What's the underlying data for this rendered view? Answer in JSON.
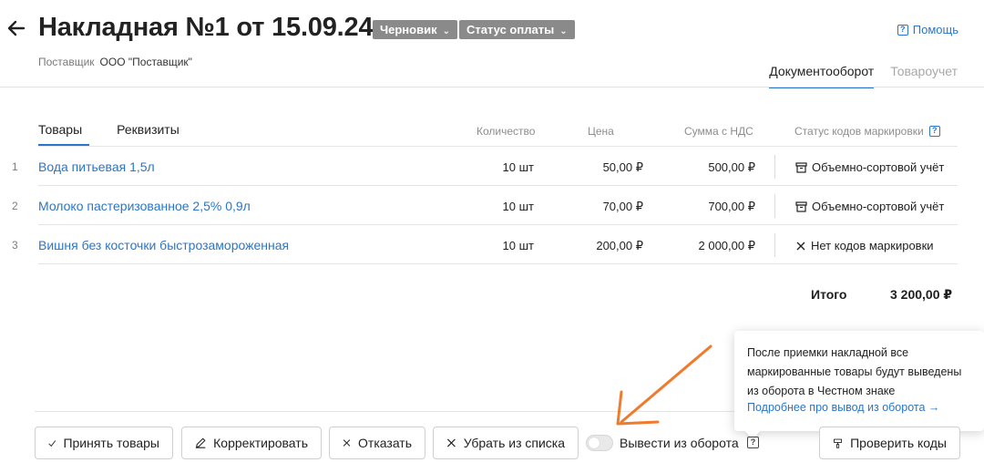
{
  "header": {
    "title": "Накладная №1 от 15.09.24",
    "tags": [
      {
        "label": "Черновик"
      },
      {
        "label": "Статус оплаты"
      }
    ],
    "help_label": "Помощь",
    "supplier_label": "Поставщик",
    "supplier_value": "ООО \"Поставщик\"",
    "tabs": [
      {
        "label": "Документооборот",
        "active": true
      },
      {
        "label": "Товароучет",
        "active": false
      }
    ]
  },
  "content": {
    "sub_tabs": [
      {
        "label": "Товары",
        "active": true
      },
      {
        "label": "Реквизиты",
        "active": false
      }
    ],
    "columns": {
      "quantity": "Количество",
      "price": "Цена",
      "sum_vat": "Сумма с НДС",
      "marking_status": "Статус кодов маркировки"
    },
    "rows": [
      {
        "num": "1",
        "name": "Вода питьевая  1,5л",
        "qty": "10 шт",
        "price": "50,00 ₽",
        "sum": "500,00 ₽",
        "status": "Объемно-сортовой учёт",
        "status_icon": "box-icon"
      },
      {
        "num": "2",
        "name": "Молоко пастеризованное 2,5% 0,9л",
        "qty": "10 шт",
        "price": "70,00 ₽",
        "sum": "700,00 ₽",
        "status": "Объемно-сортовой учёт",
        "status_icon": "box-icon"
      },
      {
        "num": "3",
        "name": "Вишня без косточки быстрозамороженная",
        "qty": "10 шт",
        "price": "200,00 ₽",
        "sum": "2 000,00 ₽",
        "status": "Нет кодов маркировки",
        "status_icon": "cross-icon"
      }
    ],
    "total_label": "Итого",
    "total_value": "3 200,00 ₽"
  },
  "popover": {
    "text": "После приемки накладной все маркированные товары будут выведены из оборота в Честном знаке",
    "link": "Подробнее про вывод из оборота →"
  },
  "footer": {
    "accept": "Принять товары",
    "correct": "Корректировать",
    "reject": "Отказать",
    "remove": "Убрать из списка",
    "toggle_label": "Вывести из оборота",
    "toggle_on": false,
    "check_codes": "Проверить коды"
  },
  "colors": {
    "accent": "#2a76c8",
    "tag_bg": "#8a8a8a",
    "annotation_arrow": "#f07a2e"
  }
}
